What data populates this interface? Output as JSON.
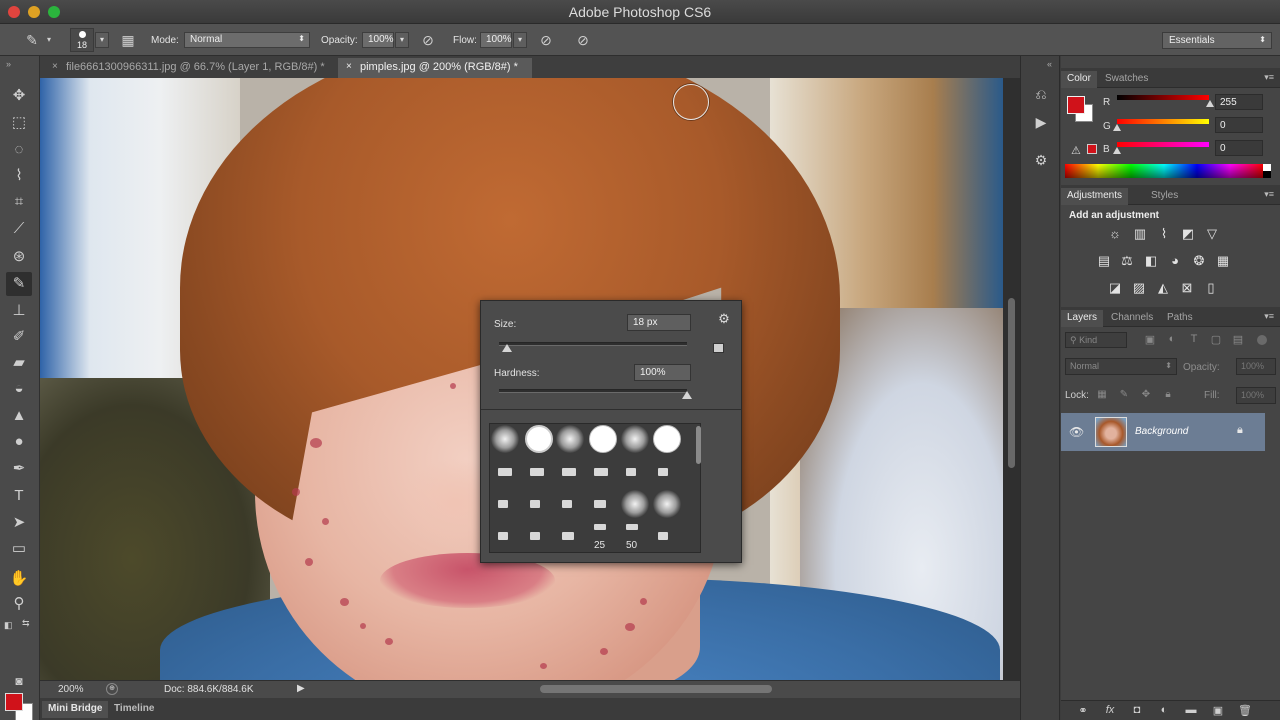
{
  "window": {
    "title": "Adobe Photoshop CS6"
  },
  "options_bar": {
    "brush_size": "18",
    "mode_label": "Mode:",
    "mode_value": "Normal",
    "opacity_label": "Opacity:",
    "opacity_value": "100%",
    "flow_label": "Flow:",
    "flow_value": "100%",
    "workspace": "Essentials"
  },
  "tabs": [
    {
      "label": "file6661300966311.jpg @ 66.7% (Layer 1, RGB/8#) *",
      "close": "×",
      "active": false
    },
    {
      "label": "pimples.jpg @ 200% (RGB/8#) *",
      "close": "×",
      "active": true
    }
  ],
  "status": {
    "zoom": "200%",
    "doc": "Doc: 884.6K/884.6K"
  },
  "bottom_tabs": [
    "Mini Bridge",
    "Timeline"
  ],
  "brush_popup": {
    "size_label": "Size:",
    "size_value": "18 px",
    "size_fraction": 0.04,
    "hardness_label": "Hardness:",
    "hardness_value": "100%",
    "hardness_fraction": 1.0,
    "preset_numbers": [
      "25",
      "50"
    ]
  },
  "color_panel": {
    "tabs": [
      "Color",
      "Swatches"
    ],
    "r_label": "R",
    "r_value": "255",
    "g_label": "G",
    "g_value": "0",
    "b_label": "B",
    "b_value": "0",
    "foreground": "#d0121a",
    "background": "#ffffff"
  },
  "adjustments_panel": {
    "tabs": [
      "Adjustments",
      "Styles"
    ],
    "title": "Add an adjustment"
  },
  "layers_panel": {
    "tabs": [
      "Layers",
      "Channels",
      "Paths"
    ],
    "kind": "Kind",
    "blend_mode": "Normal",
    "opacity_label": "Opacity:",
    "opacity_value": "100%",
    "lock_label": "Lock:",
    "fill_label": "Fill:",
    "fill_value": "100%",
    "layers": [
      {
        "name": "Background",
        "locked": true,
        "visible": true
      }
    ]
  },
  "tools": [
    "move-tool",
    "marquee-tool",
    "lasso-tool",
    "quick-selection-tool",
    "crop-tool",
    "eyedropper-tool",
    "spot-healing-tool",
    "brush-tool",
    "clone-stamp-tool",
    "history-brush-tool",
    "eraser-tool",
    "paint-bucket-tool",
    "blur-tool",
    "dodge-tool",
    "pen-tool",
    "type-tool",
    "path-selection-tool",
    "rectangle-tool",
    "hand-tool",
    "zoom-tool"
  ]
}
